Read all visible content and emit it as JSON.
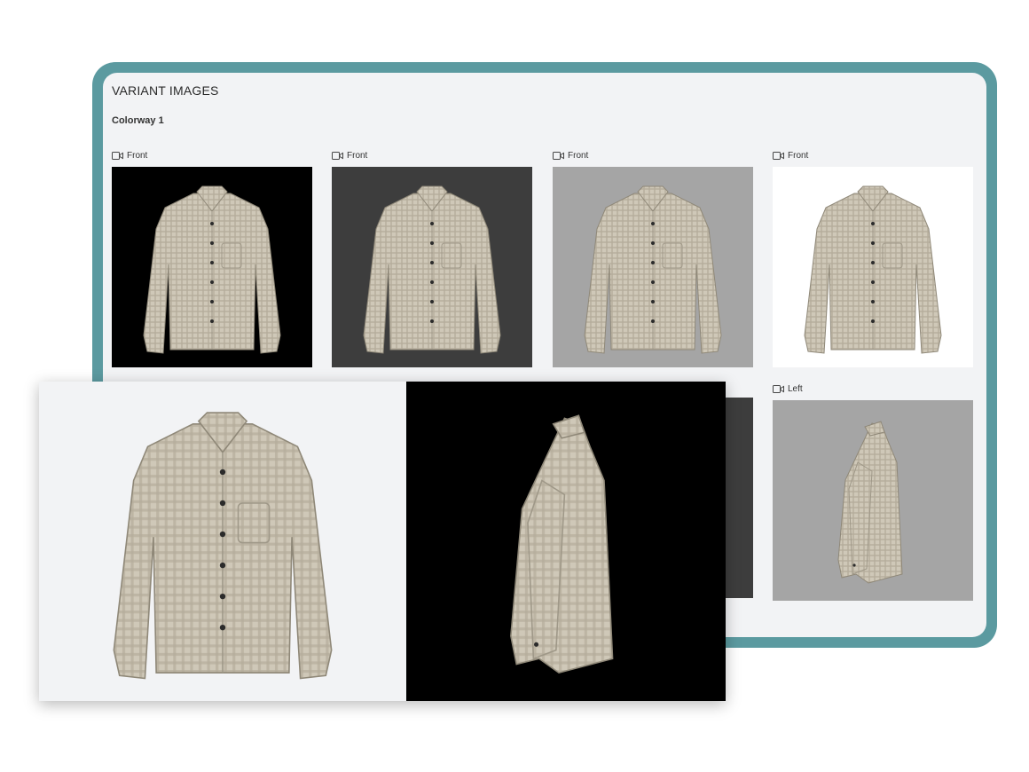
{
  "panel": {
    "title": "VARIANT IMAGES",
    "colorway": "Colorway 1"
  },
  "cards": [
    {
      "label": "Front",
      "view": "front",
      "bg": "#000000"
    },
    {
      "label": "Front",
      "view": "front",
      "bg": "#3d3d3d"
    },
    {
      "label": "Front",
      "view": "front",
      "bg": "#a5a5a5"
    },
    {
      "label": "Front",
      "view": "front",
      "bg": "#ffffff"
    },
    {
      "label": "Left",
      "view": "side",
      "bg": "#a5a5a5"
    }
  ],
  "hidden_dark_bg": "#3d3d3d",
  "overlay": {
    "left_bg": "#f2f3f5",
    "right_bg": "#000000"
  },
  "colors": {
    "frame": "#5b9aa0",
    "shirt_base": "#cfc8b8",
    "shirt_check": "#b5ad9c",
    "button": "#2b2b2b"
  }
}
